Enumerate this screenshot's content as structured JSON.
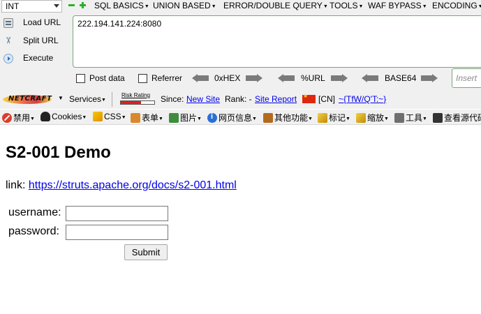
{
  "hackbar": {
    "int_select": "INT",
    "menu": [
      "SQL BASICS",
      "UNION BASED",
      "ERROR/DOUBLE QUERY",
      "TOOLS",
      "WAF BYPASS",
      "ENCODING"
    ],
    "buttons": {
      "load_url": "Load URL",
      "split_url": "Split URL",
      "execute": "Execute"
    },
    "url_value": "222.194.141.224:8080",
    "post_data": "Post data",
    "referrer": "Referrer",
    "encoders": [
      "0xHEX",
      "%URL",
      "BASE64"
    ],
    "insert_placeholder": "Insert "
  },
  "netcraft": {
    "logo": "NETCRAFT",
    "services": "Services",
    "risk_rating": "Risk Rating",
    "since_label": "Since:",
    "since_value": "New Site",
    "rank_label": "Rank: -",
    "site_report": "Site Report",
    "country": "[CN]",
    "host_link": "~{TfW/Q'T:~}"
  },
  "cn_toolbar": {
    "items": [
      "禁用",
      "Cookies",
      "CSS",
      "表单",
      "图片",
      "网页信息",
      "其他功能",
      "标记",
      "缩放",
      "工具",
      "查看源代码"
    ]
  },
  "page": {
    "title": "S2-001 Demo",
    "link_label": "link:",
    "link_url": "https://struts.apache.org/docs/s2-001.html",
    "username_label": "username:",
    "password_label": "password:",
    "submit_label": "Submit"
  }
}
